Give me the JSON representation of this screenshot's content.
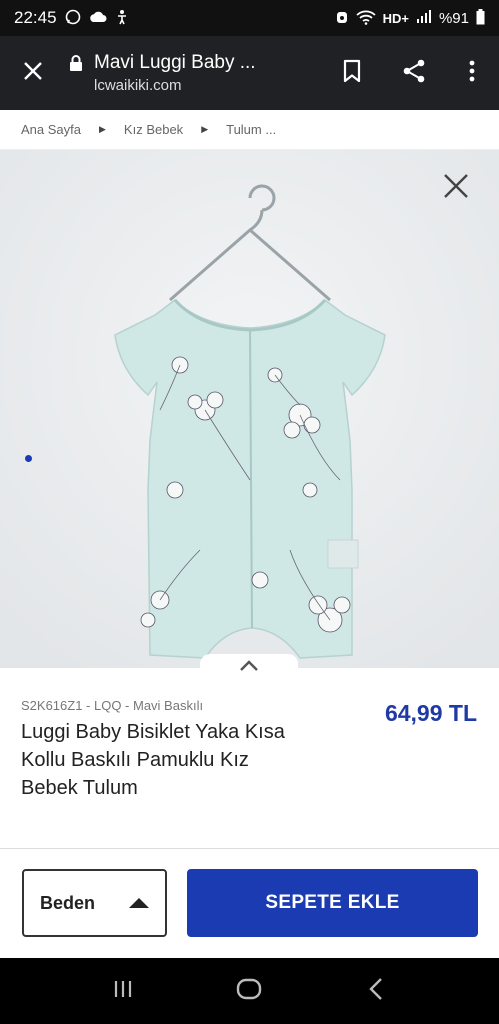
{
  "status_bar": {
    "time": "22:45",
    "network": "HD+",
    "battery": "%91"
  },
  "browser": {
    "title": "Mavi Luggi Baby ...",
    "url": "lcwaikiki.com"
  },
  "breadcrumb": [
    {
      "label": "Ana Sayfa"
    },
    {
      "label": "Kız Bebek"
    },
    {
      "label": "Tulum ..."
    }
  ],
  "product": {
    "sku": "S2K616Z1 - LQQ - Mavi Baskılı",
    "name": "Luggi Baby Bisiklet Yaka Kısa Kollu Baskılı Pamuklu Kız Bebek Tulum",
    "price": "64,99 TL",
    "color_accent": "#1b3bb3",
    "garment_color": "#cde6e4"
  },
  "actions": {
    "size_label": "Beden",
    "add_to_cart_label": "SEPETE EKLE"
  },
  "icons": [
    "whatsapp-icon",
    "cloud-icon",
    "accessibility-icon",
    "alarm-icon",
    "wifi-icon",
    "signal-icon",
    "close-icon",
    "lock-icon",
    "bookmark-icon",
    "share-icon",
    "more-icon",
    "chevron-up-icon",
    "recents-icon",
    "home-icon",
    "back-icon"
  ]
}
